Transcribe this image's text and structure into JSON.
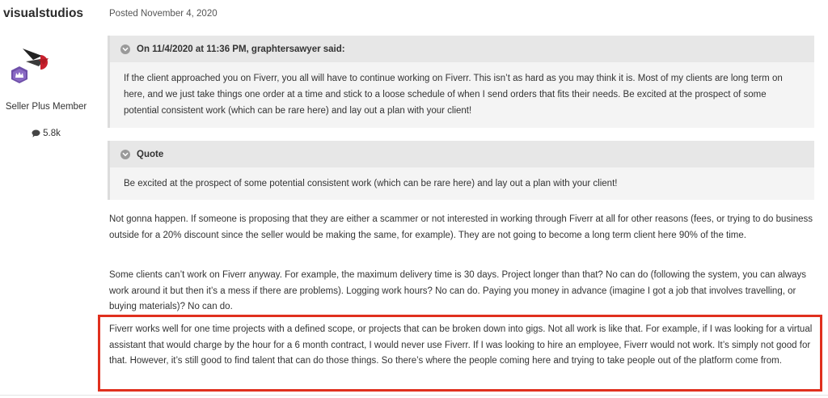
{
  "author": {
    "name": "visualstudios",
    "title": "Seller Plus Member",
    "post_count": "5.8k"
  },
  "post": {
    "date": "Posted November 4, 2020",
    "quotes": [
      {
        "header": "On 11/4/2020 at 11:36 PM, graphtersawyer said:",
        "body": "If the client approached you on Fiverr, you all will have to continue working on Fiverr. This isn’t as hard as you may think it is. Most of my clients are long term on here, and we just take things one order at a time and stick to a loose schedule of when I send orders that fits their needs. Be excited at the prospect of some potential consistent work (which can be rare here) and lay out a plan with your client!"
      },
      {
        "header": "Quote",
        "body": "Be excited at the prospect of some potential consistent work (which can be rare here) and lay out a plan with your client!"
      }
    ],
    "paragraphs": [
      "Not gonna happen. If someone is proposing that they are either a scammer or not interested in working through Fiverr at all for other reasons (fees, or trying to do business outside for a 20% discount since the seller would be making the same, for example). They are not going to become a long term client here 90% of the time.",
      "Some clients can’t work on Fiverr anyway. For example, the maximum delivery time is 30 days. Project longer than that? No can do (following the system, you can always work around it but then it’s a mess if there are problems). Logging work hours? No can do. Paying you money in advance (imagine I got a job that involves travelling, or buying materials)? No can do.",
      "Fiverr works well for one time projects with a defined scope, or projects that can be broken down into gigs. Not all work is like that. For example, if I was looking for a virtual assistant that would charge by the hour for a 6 month contract, I would never use Fiverr. If I was looking to hire an employee, Fiverr would not work. It’s simply not good for that. However, it’s still good to find talent that can do those things. So there’s where the people coming here and trying to take people out of the platform come from."
    ]
  },
  "colors": {
    "highlight_border": "#e0301e",
    "quote_header_bg": "#e7e7e7",
    "quote_body_bg": "#f4f4f4"
  },
  "icons": {
    "avatar": "seller-plus-badge",
    "post_count": "speech-bubble-icon",
    "quote_toggle": "chevron-down-icon"
  }
}
